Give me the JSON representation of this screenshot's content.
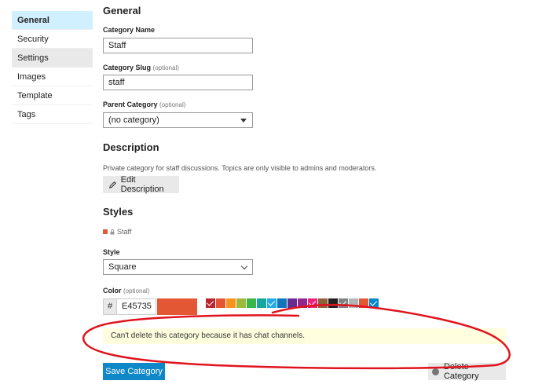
{
  "sidebar": {
    "items": [
      {
        "label": "General"
      },
      {
        "label": "Security"
      },
      {
        "label": "Settings"
      },
      {
        "label": "Images"
      },
      {
        "label": "Template"
      },
      {
        "label": "Tags"
      }
    ]
  },
  "general": {
    "heading": "General",
    "name_label": "Category Name",
    "name_value": "Staff",
    "slug_label": "Category Slug",
    "slug_optional": "(optional)",
    "slug_value": "staff",
    "parent_label": "Parent Category",
    "parent_optional": "(optional)",
    "parent_value": "(no category)"
  },
  "description": {
    "heading": "Description",
    "text": "Private category for staff discussions. Topics are only visible to admins and moderators.",
    "edit_button": "Edit Description"
  },
  "styles": {
    "heading": "Styles",
    "badge_label": "Staff",
    "badge_color": "#E45735",
    "style_label": "Style",
    "style_value": "Square",
    "color_label": "Color",
    "color_optional": "(optional)",
    "hash": "#",
    "color_value": "E45735",
    "preview_color": "#E45735",
    "swatches": [
      {
        "color": "#BA25336",
        "checked": true
      },
      {
        "color": "#E45735",
        "checked": false
      },
      {
        "color": "#F7941D",
        "checked": false
      },
      {
        "color": "#9EB83B",
        "checked": false
      },
      {
        "color": "#3AB54A",
        "checked": false
      },
      {
        "color": "#12A89D",
        "checked": false
      },
      {
        "color": "#25AAE2",
        "checked": true
      },
      {
        "color": "#0E76BD",
        "checked": false
      },
      {
        "color": "#652D90",
        "checked": false
      },
      {
        "color": "#92278F",
        "checked": false
      },
      {
        "color": "#ED207B",
        "checked": true
      },
      {
        "color": "#8C6238",
        "checked": false
      },
      {
        "color": "#231F20",
        "checked": false
      },
      {
        "color": "#808281",
        "checked": true
      },
      {
        "color": "#B3B5B4",
        "checked": false
      },
      {
        "color": "#E45735",
        "checked": false
      },
      {
        "color": "#0088CC",
        "checked": true
      }
    ]
  },
  "notice": {
    "text": "Can't delete this category because it has chat channels."
  },
  "footer": {
    "save_label": "Save Category",
    "delete_label": "Delete Category"
  },
  "annotation_color": "#e0141e"
}
